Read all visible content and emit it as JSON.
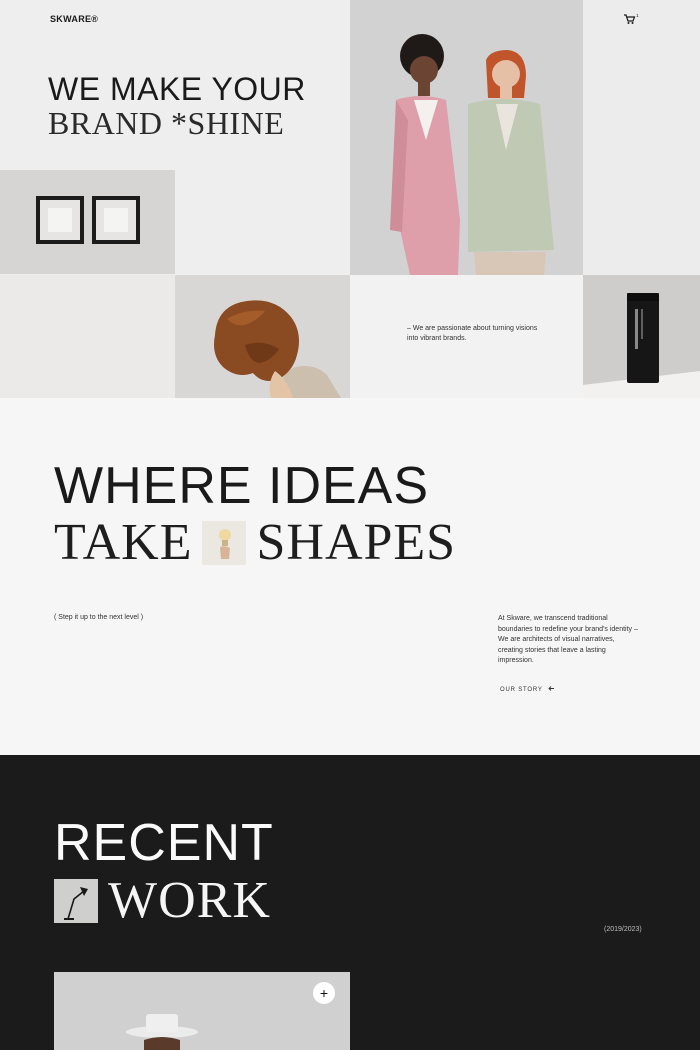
{
  "header": {
    "brand": "SKWARE®",
    "cart_icon": "cart-icon",
    "cart_count": "1"
  },
  "hero": {
    "title_line1": "WE MAKE YOUR",
    "title_line2": "BRAND *SHINE",
    "tagline": "– We are passionate about turning visions into vibrant brands."
  },
  "ideas": {
    "title_line1": "WHERE IDEAS",
    "title_word1": "TAKE",
    "title_word2": "SHAPES",
    "step_label": "( Step it up to the next level )",
    "about_text": "At Skware, we transcend traditional boundaries to redefine your brand's identity – We are architects of visual narratives, creating stories that leave a lasting impression.",
    "story_link": "OUR STORY",
    "story_icon": "arrow-left-icon"
  },
  "recent": {
    "title_line1": "RECENT",
    "title_word": "WORK",
    "years": "(2019/2023)",
    "plus_label": "+"
  },
  "colors": {
    "dark_bg": "#1c1b1b",
    "light_bg": "#f7f6f6",
    "text": "#1b1a1a"
  }
}
